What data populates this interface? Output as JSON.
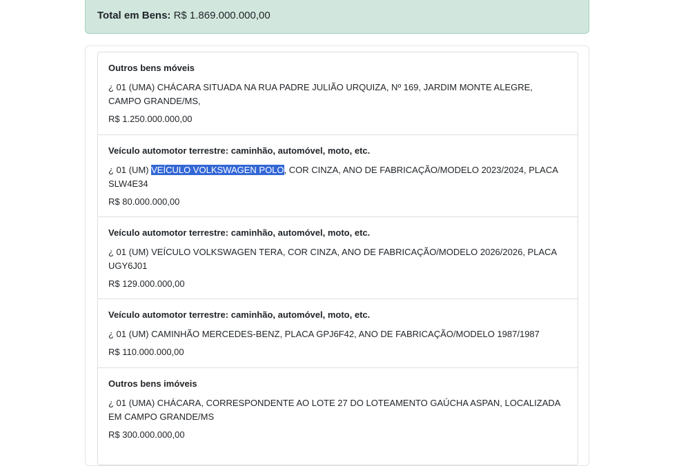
{
  "summary": {
    "label": "Total em Bens:",
    "value": "R$ 1.869.000.000,00"
  },
  "items": [
    {
      "title": "Outros bens móveis",
      "desc_pre": "",
      "desc_highlight": "",
      "desc_post": "¿ 01 (UMA) CHÁCARA SITUADA NA RUA PADRE JULIÃO URQUIZA, Nº 169, JARDIM MONTE ALEGRE, CAMPO GRANDE/MS,",
      "value": "R$ 1.250.000.000,00"
    },
    {
      "title": "Veículo automotor terrestre: caminhão, automóvel, moto, etc.",
      "desc_pre": "¿ 01 (UM) ",
      "desc_highlight": "VEÍCULO VOLKSWAGEN POLO",
      "desc_post": ", COR CINZA, ANO DE FABRICAÇÃO/MODELO 2023/2024, PLACA SLW4E34",
      "value": "R$ 80.000.000,00"
    },
    {
      "title": "Veículo automotor terrestre: caminhão, automóvel, moto, etc.",
      "desc_pre": "",
      "desc_highlight": "",
      "desc_post": "¿ 01 (UM) VEÍCULO VOLKSWAGEN TERA, COR CINZA, ANO DE FABRICAÇÃO/MODELO 2026/2026, PLACA UGY6J01",
      "value": "R$ 129.000.000,00"
    },
    {
      "title": "Veículo automotor terrestre: caminhão, automóvel, moto, etc.",
      "desc_pre": "",
      "desc_highlight": "",
      "desc_post": "¿ 01 (UM) CAMINHÃO MERCEDES-BENZ, PLACA GPJ6F42, ANO DE FABRICAÇÃO/MODELO 1987/1987",
      "value": "R$ 110.000.000,00"
    },
    {
      "title": "Outros bens imóveis",
      "desc_pre": "",
      "desc_highlight": "",
      "desc_post": "¿ 01 (UMA) CHÁCARA, CORRESPONDENTE AO LOTE 27 DO LOTEAMENTO GAÚCHA ASPAN, LOCALIZADA EM CAMPO GRANDE/MS",
      "value": "R$ 300.000.000,00"
    }
  ]
}
